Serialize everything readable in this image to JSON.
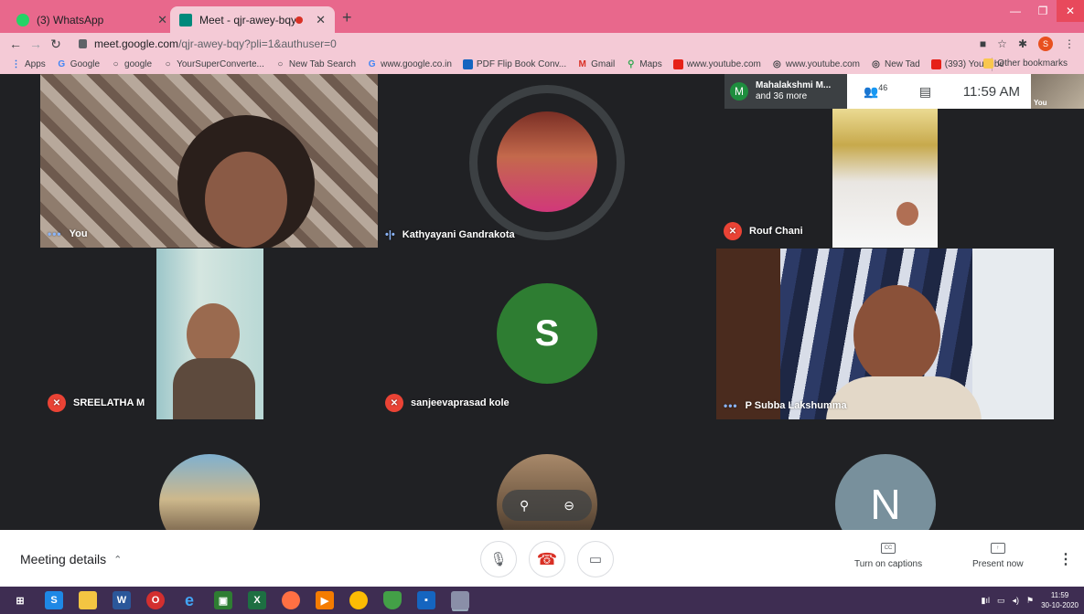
{
  "browser": {
    "tabs": [
      {
        "title": "(3) WhatsApp",
        "favicon": "whatsapp-icon",
        "color": "#25d366"
      },
      {
        "title": "Meet - qjr-awey-bqy",
        "favicon": "meet-icon",
        "color": "#00897b"
      }
    ],
    "new_tab": "+",
    "url_host": "meet.google.com",
    "url_path": "/qjr-awey-bqy?pli=1&authuser=0",
    "profile_initial": "S",
    "bookmarks": [
      {
        "label": "Apps",
        "icon": "apps-grid-icon"
      },
      {
        "label": "Google",
        "icon": "google-icon"
      },
      {
        "label": "google",
        "icon": "search-icon"
      },
      {
        "label": "YourSuperConverte...",
        "icon": "search-icon"
      },
      {
        "label": "New Tab Search",
        "icon": "search-icon"
      },
      {
        "label": "www.google.co.in",
        "icon": "google-icon"
      },
      {
        "label": "PDF Flip Book Conv...",
        "icon": "book-icon"
      },
      {
        "label": "Gmail",
        "icon": "gmail-icon"
      },
      {
        "label": "Maps",
        "icon": "maps-icon"
      },
      {
        "label": "www.youtube.com",
        "icon": "youtube-icon"
      },
      {
        "label": "www.youtube.com",
        "icon": "globe-icon"
      },
      {
        "label": "New Tad",
        "icon": "globe-icon"
      },
      {
        "label": "(393) YouTube",
        "icon": "youtube-icon"
      }
    ],
    "other_bookmarks": "Other bookmarks"
  },
  "meet": {
    "host_initial": "M",
    "host_name": "Mahalakshmi M...",
    "host_more": "and 36 more",
    "participants_count": "46",
    "time": "11:59 AM",
    "self_label": "You",
    "tiles": [
      {
        "name": "You",
        "status": "speaking-dots"
      },
      {
        "name": "Kathyayani Gandrakota",
        "status": "speaking-wave"
      },
      {
        "name": "Rouf Chani",
        "status": "muted"
      },
      {
        "name": "SREELATHA M",
        "status": "muted"
      },
      {
        "name": "sanjeevaprasad kole",
        "status": "muted",
        "initial": "S"
      },
      {
        "name": "P Subba Lakshumma",
        "status": "speaking-dots"
      }
    ],
    "bottom_tiles": [
      {
        "initial": ""
      },
      {
        "initial": ""
      },
      {
        "initial": "N"
      }
    ],
    "meeting_details": "Meeting details",
    "captions_label": "Turn on captions",
    "present_label": "Present now"
  },
  "taskbar": {
    "clock_time": "11:59",
    "clock_date": "30-10-2020"
  },
  "colors": {
    "meet_bg": "#202124",
    "hangup": "#d93025",
    "mute_red": "#ea4335",
    "avatar_green": "#2e7d32",
    "avatar_gray": "#78909c"
  }
}
